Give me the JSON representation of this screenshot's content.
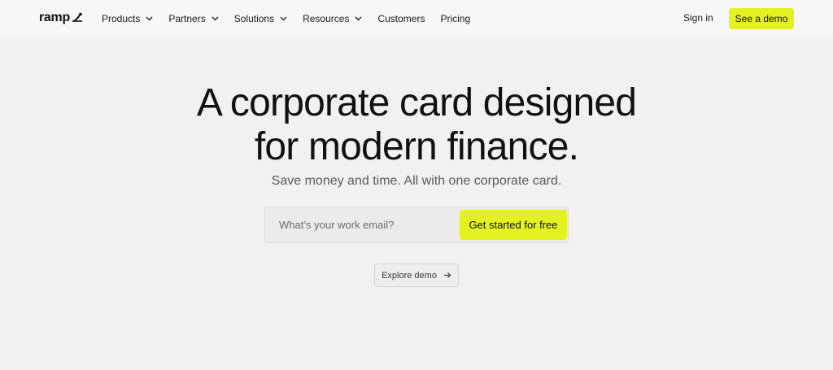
{
  "nav": {
    "logo_text": "ramp",
    "items": [
      {
        "label": "Products",
        "has_dropdown": true
      },
      {
        "label": "Partners",
        "has_dropdown": true
      },
      {
        "label": "Solutions",
        "has_dropdown": true
      },
      {
        "label": "Resources",
        "has_dropdown": true
      },
      {
        "label": "Customers",
        "has_dropdown": false
      },
      {
        "label": "Pricing",
        "has_dropdown": false
      }
    ],
    "sign_in": "Sign in",
    "cta": "See a demo"
  },
  "hero": {
    "title_line1": "A corporate card designed",
    "title_line2": "for modern finance.",
    "subtitle": "Save money and time. All with one corporate card.",
    "email_placeholder": "What’s your work email?",
    "email_value": "",
    "submit_label": "Get started for free",
    "explore_label": "Explore demo"
  },
  "colors": {
    "accent": "#e4f222",
    "background": "#f2f1ef",
    "nav_background": "#f8f7f5",
    "text": "#111111"
  },
  "icons": {
    "logo_mark": "ramp-logo-icon",
    "dropdown": "chevron-down-icon",
    "explore": "arrow-right-icon"
  }
}
